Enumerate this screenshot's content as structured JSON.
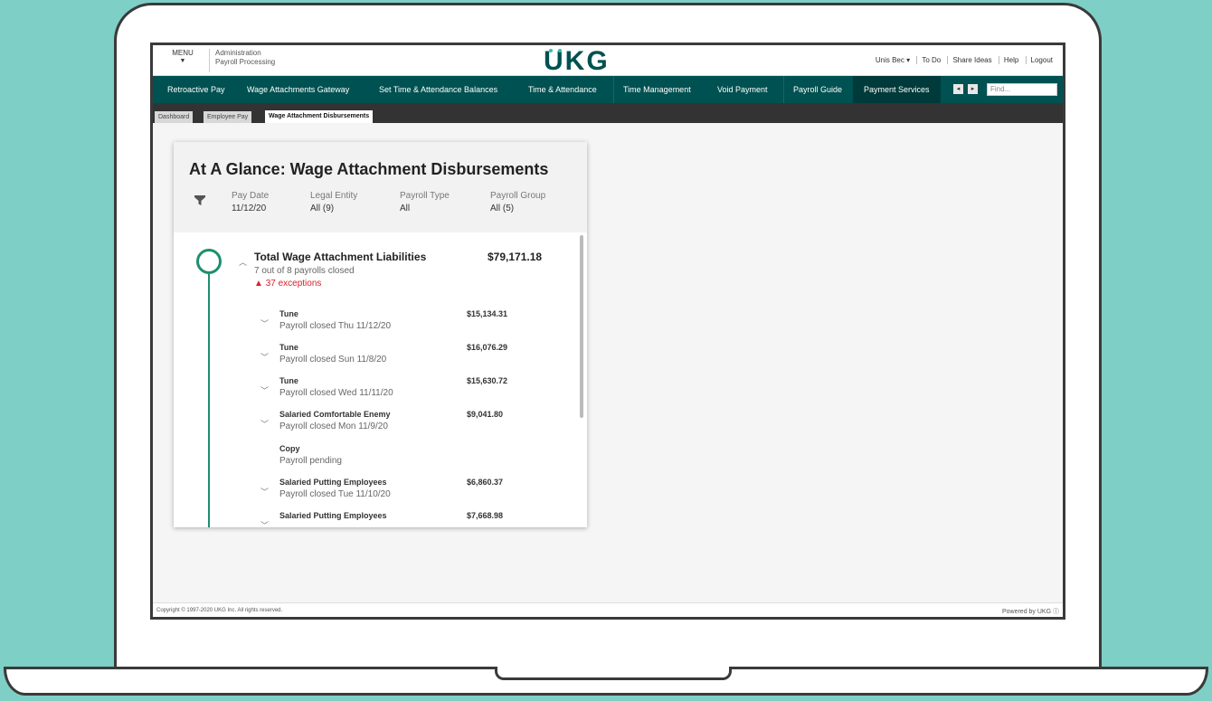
{
  "topbar": {
    "menu_label": "MENU",
    "crumb_line1": "Administration",
    "crumb_line2": "Payroll Processing",
    "logo": "UKG",
    "links": [
      "Unis Bec ▾",
      "To Do",
      "Share Ideas",
      "Help",
      "Logout"
    ]
  },
  "nav": {
    "items": [
      "Retroactive Pay",
      "Wage Attachments Gateway",
      "Set Time & Attendance Balances",
      "Time & Attendance",
      "Time Management",
      "Void Payment",
      "Payroll Guide",
      "Payment Services"
    ],
    "find_placeholder": "Find..."
  },
  "subtabs": [
    "Dashboard",
    "Employee Pay",
    "Wage Attachment Disbursements"
  ],
  "card": {
    "title": "At A Glance: Wage Attachment Disbursements",
    "filters": [
      {
        "label": "Pay Date",
        "value": "11/12/20"
      },
      {
        "label": "Legal Entity",
        "value": "All (9)"
      },
      {
        "label": "Payroll Type",
        "value": "All"
      },
      {
        "label": "Payroll Group",
        "value": "All (5)"
      }
    ],
    "total": {
      "title": "Total Wage Attachment Liabilities",
      "amount": "$79,171.18",
      "subtitle": "7 out of 8 payrolls closed",
      "exceptions": "37 exceptions"
    },
    "rows": [
      {
        "name": "Tune",
        "status": "Payroll closed Thu 11/12/20",
        "amount": "$15,134.31"
      },
      {
        "name": "Tune",
        "status": "Payroll closed Sun 11/8/20",
        "amount": "$16,076.29"
      },
      {
        "name": "Tune",
        "status": "Payroll closed Wed 11/11/20",
        "amount": "$15,630.72"
      },
      {
        "name": "Salaried Comfortable Enemy",
        "status": "Payroll closed Mon 11/9/20",
        "amount": "$9,041.80"
      },
      {
        "name": "Copy",
        "status": "Payroll pending",
        "amount": ""
      },
      {
        "name": "Salaried Putting Employees",
        "status": "Payroll closed Tue 11/10/20",
        "amount": "$6,860.37"
      },
      {
        "name": "Salaried Putting Employees",
        "status": "",
        "amount": "$7,668.98"
      }
    ]
  },
  "footer": {
    "copyright": "Copyright © 1997-2020 UKG Inc. All rights reserved.",
    "powered": "Powered by UKG ⓘ"
  }
}
